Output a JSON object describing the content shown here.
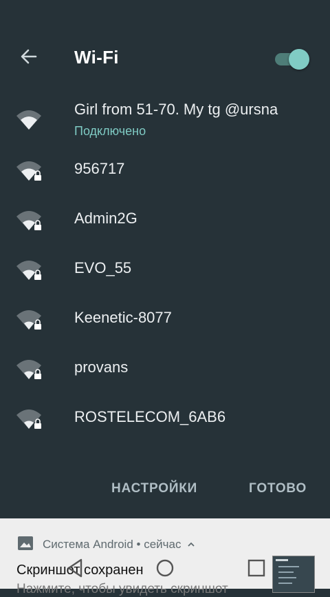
{
  "header": {
    "title": "Wi-Fi",
    "wifi_enabled": true
  },
  "networks": [
    {
      "name": "Girl from 51-70. My tg @ursna",
      "status": "Подключено",
      "locked": false
    },
    {
      "name": "956717",
      "locked": true
    },
    {
      "name": "Admin2G",
      "locked": true
    },
    {
      "name": "EVO_55",
      "locked": true
    },
    {
      "name": "Keenetic-8077",
      "locked": true
    },
    {
      "name": "provans",
      "locked": true
    },
    {
      "name": "ROSTELECOM_6AB6",
      "locked": true
    }
  ],
  "actions": {
    "settings": "НАСТРОЙКИ",
    "done": "ГОТОВО"
  },
  "notification": {
    "app": "Система Android",
    "time": "сейчас",
    "title": "Скриншот сохранен",
    "text": "Нажмите, чтобы увидеть скриншот"
  },
  "colors": {
    "background": "#263238",
    "accent": "#80cbc4",
    "notification_bg": "#eeeeee"
  }
}
